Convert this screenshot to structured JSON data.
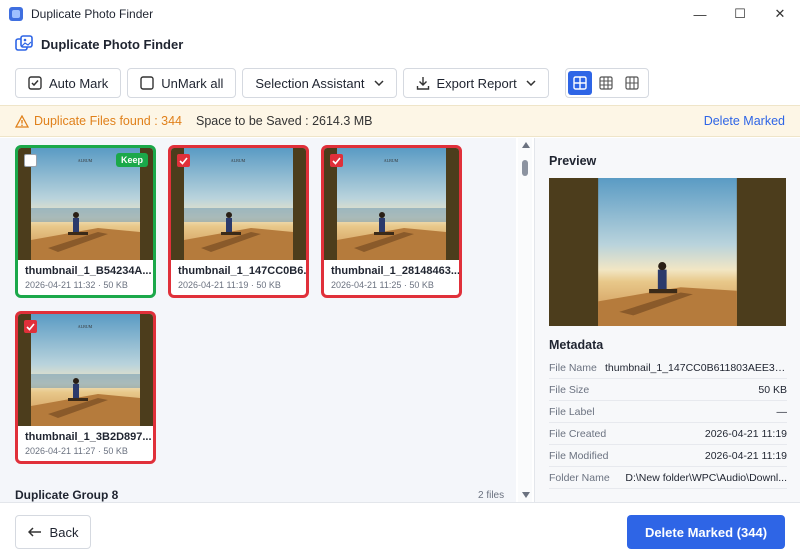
{
  "window": {
    "title": "Duplicate Photo Finder",
    "controls": [
      "—",
      "☐",
      "✕"
    ]
  },
  "app": {
    "title": "Duplicate Photo Finder"
  },
  "toolbar": {
    "auto_mark": "Auto Mark",
    "unmark_all": "UnMark all",
    "selection_assistant": "Selection Assistant",
    "export_report": "Export Report",
    "view_modes": [
      "large-grid",
      "medium-grid",
      "small-grid"
    ],
    "active_view": 0
  },
  "infobar": {
    "found": "Duplicate Files found : 344",
    "space": "Space to be Saved : 2614.3 MB",
    "delete_marked": "Delete Marked"
  },
  "gallery": {
    "items": [
      {
        "name": "thumbnail_1_B54234A...",
        "meta": "2026-04-21 11:32 · 50 KB",
        "checked": false,
        "keep": true,
        "badge": "Keep"
      },
      {
        "name": "thumbnail_1_147CC0B6...",
        "meta": "2026-04-21 11:19 · 50 KB",
        "checked": true,
        "keep": false
      },
      {
        "name": "thumbnail_1_28148463...",
        "meta": "2026-04-21 11:25 · 50 KB",
        "checked": true,
        "keep": false
      },
      {
        "name": "thumbnail_1_3B2D897...",
        "meta": "2026-04-21 11:27 · 50 KB",
        "checked": true,
        "keep": false
      }
    ],
    "next_group": {
      "title": "Duplicate Group 8",
      "count": "2 files"
    }
  },
  "side": {
    "preview_title": "Preview",
    "metadata_title": "Metadata",
    "rows": [
      {
        "label": "File Name",
        "value": "thumbnail_1_147CC0B611803AEE3B3..."
      },
      {
        "label": "File Size",
        "value": "50 KB"
      },
      {
        "label": "File Label",
        "value": "—"
      },
      {
        "label": "File Created",
        "value": "2026-04-21 11:19"
      },
      {
        "label": "File Modified",
        "value": "2026-04-21 11:19"
      },
      {
        "label": "Folder Name",
        "value": "D:\\New folder\\WPC\\Audio\\Downl..."
      }
    ]
  },
  "footer": {
    "back": "Back",
    "delete": "Delete Marked (344)"
  },
  "colors": {
    "accent": "#2e65e6",
    "keep": "#1ba84a",
    "marked": "#e0303a",
    "warning": "#e0801a"
  }
}
